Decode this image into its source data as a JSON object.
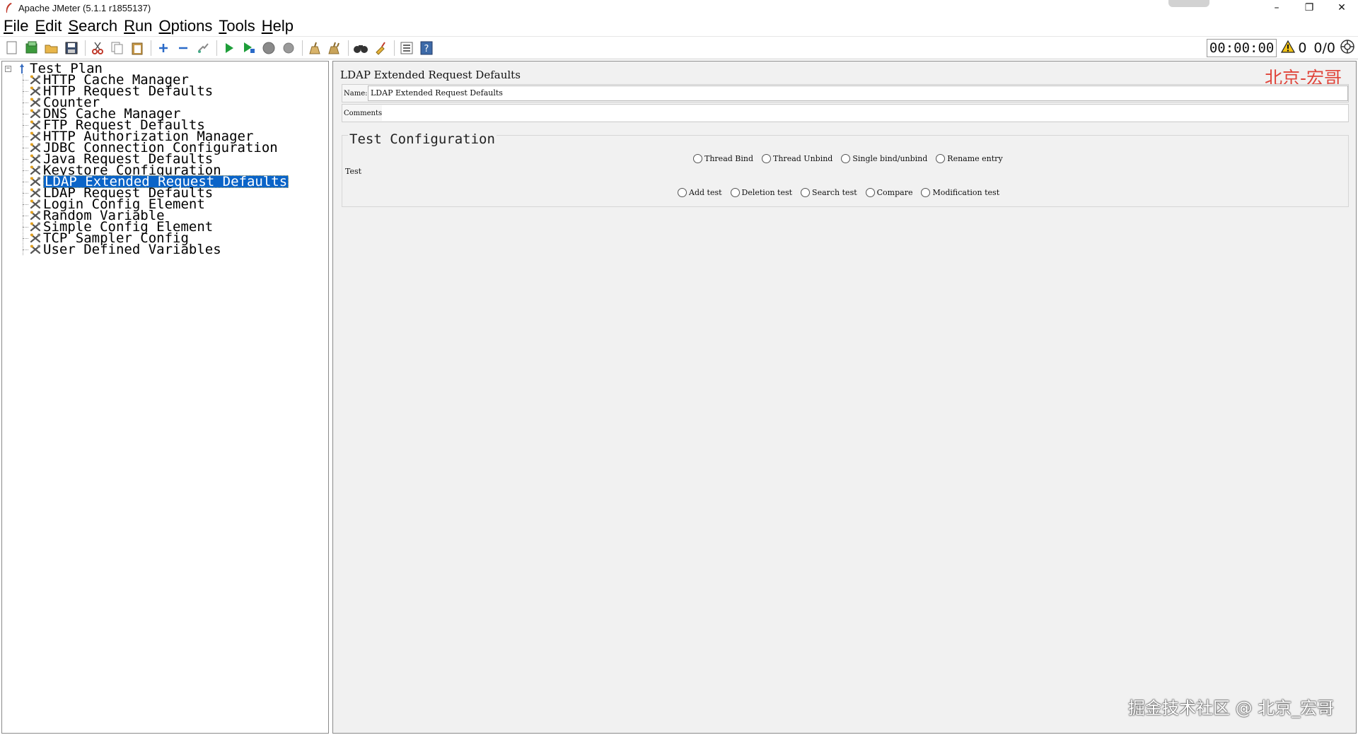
{
  "window": {
    "title": "Apache JMeter (5.1.1 r1855137)",
    "controls": {
      "minimize": "–",
      "restore": "❐",
      "close": "✕"
    }
  },
  "menu": [
    {
      "underline": "F",
      "rest": "ile"
    },
    {
      "underline": "E",
      "rest": "dit"
    },
    {
      "underline": "S",
      "rest": "earch"
    },
    {
      "underline": "R",
      "rest": "un"
    },
    {
      "underline": "O",
      "rest": "ptions"
    },
    {
      "underline": "T",
      "rest": "ools"
    },
    {
      "underline": "H",
      "rest": "elp"
    }
  ],
  "toolbar": {
    "timer": "00:00:00",
    "warnings": "0",
    "threads": "0/0"
  },
  "tree": {
    "root": "Test Plan",
    "items": [
      "HTTP Cache Manager",
      "HTTP Request Defaults",
      "Counter",
      "DNS Cache Manager",
      "FTP Request Defaults",
      "HTTP Authorization Manager",
      "JDBC Connection Configuration",
      "Java Request Defaults",
      "Keystore Configuration",
      "LDAP Extended Request Defaults",
      "LDAP Request Defaults",
      "Login Config Element",
      "Random Variable",
      "Simple Config Element",
      "TCP Sampler Config",
      "User Defined Variables"
    ],
    "selected_index": 9
  },
  "panel": {
    "title": "LDAP Extended Request Defaults",
    "watermark": "北京-宏哥",
    "name_label": "Name:",
    "name_value": "LDAP Extended Request Defaults",
    "comments_label": "Comments:",
    "comments_value": "",
    "group_title": "Test Configuration",
    "group_label": "Test",
    "radios_row1": [
      "Thread Bind",
      "Thread Unbind",
      "Single bind/unbind",
      "Rename entry"
    ],
    "radios_row2": [
      "Add test",
      "Deletion test",
      "Search test",
      "Compare",
      "Modification test"
    ]
  },
  "footer_watermark": "掘金技术社区 @ 北京_宏哥"
}
